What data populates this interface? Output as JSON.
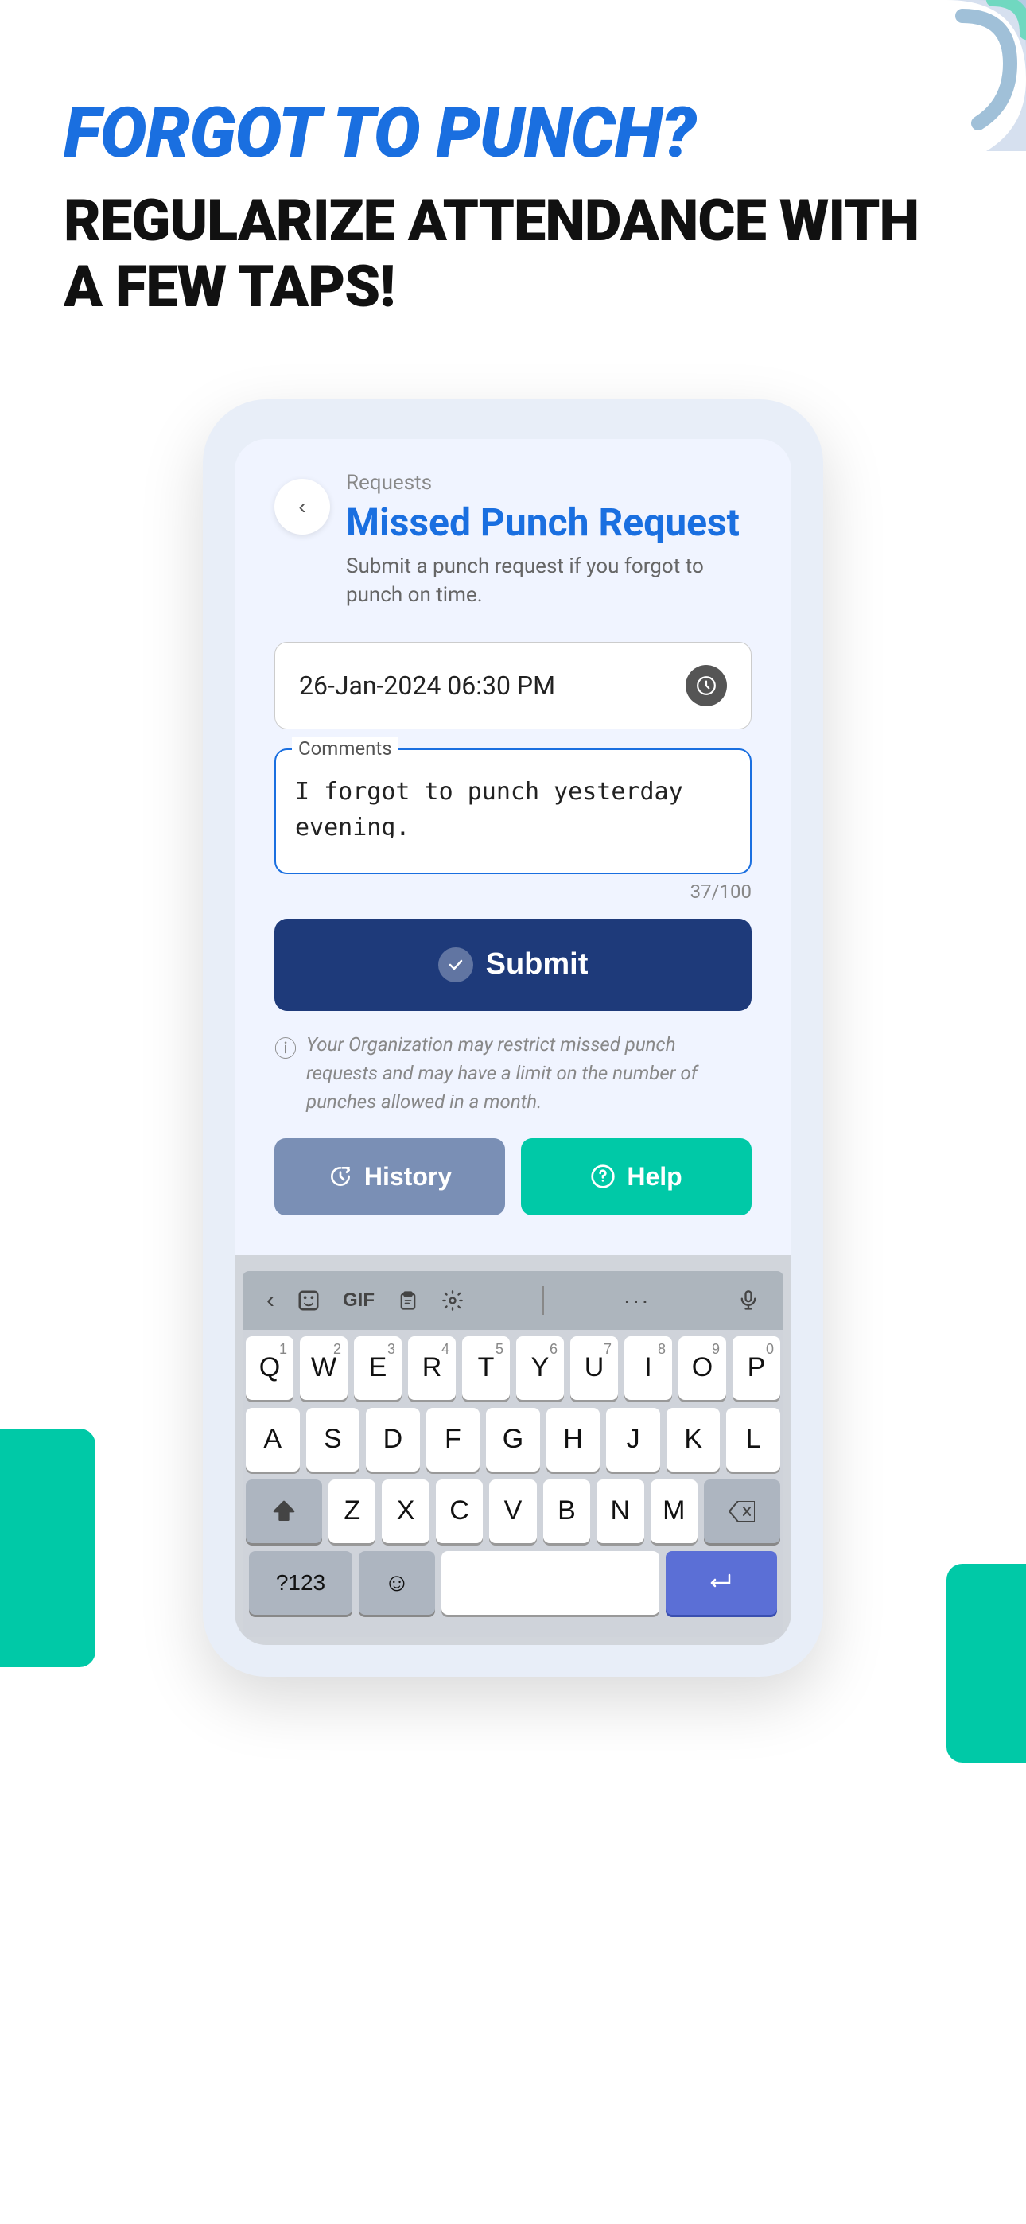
{
  "hero": {
    "title_blue": "FORGOT TO PUNCH?",
    "subtitle": "REGULARIZE ATTENDANCE WITH A FEW TAPS!"
  },
  "phone": {
    "breadcrumb": "Requests",
    "screen_title": "Missed Punch Request",
    "screen_description": "Submit a punch request if you forgot to punch on time.",
    "back_button_label": "‹",
    "datetime_value": "26-Jan-2024 06:30 PM",
    "comments_label": "Comments",
    "comments_value": "I forgot to punch yesterday evening.",
    "char_count": "37/100",
    "submit_label": "Submit",
    "info_text": "Your Organization may restrict missed punch requests and may have a limit on the number of punches allowed in a month.",
    "history_label": "History",
    "help_label": "Help"
  },
  "keyboard": {
    "toolbar": {
      "back_arrow": "‹",
      "emoji_board": "☺",
      "gif": "GIF",
      "clipboard": "📋",
      "settings": "⚙",
      "more": "···",
      "mic": "🎤"
    },
    "row1": [
      "Q",
      "W",
      "E",
      "R",
      "T",
      "Y",
      "U",
      "I",
      "O",
      "P"
    ],
    "row1_nums": [
      "1",
      "2",
      "3",
      "4",
      "5",
      "6",
      "7",
      "8",
      "9",
      "0"
    ],
    "row2": [
      "A",
      "S",
      "D",
      "F",
      "G",
      "H",
      "J",
      "K",
      "L"
    ],
    "row3": [
      "Z",
      "X",
      "C",
      "V",
      "B",
      "N",
      "M"
    ],
    "special_keys": {
      "shift": "⇧",
      "backspace": "⌫",
      "numbers": "?123",
      "emoji": "☺",
      "enter_arrow": "↵"
    }
  },
  "colors": {
    "blue_accent": "#1a6fe0",
    "dark_navy": "#1e3a7a",
    "teal": "#00c9a7",
    "history_btn": "#7a8fb5",
    "light_bg": "#f0f4ff",
    "corner_blue": "#b8c8e8",
    "corner_teal": "#7de0cc"
  }
}
